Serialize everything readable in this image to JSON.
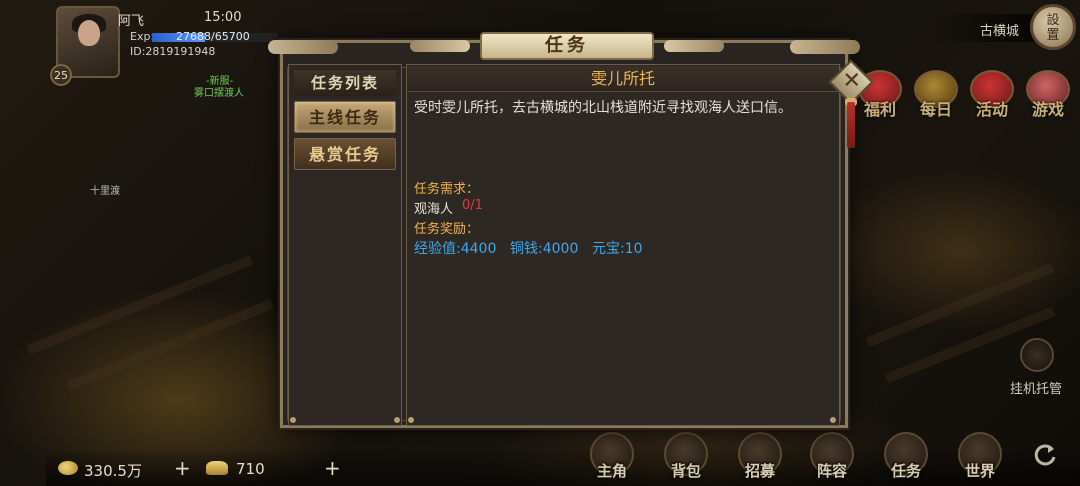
{
  "player": {
    "name": "阿飞",
    "time": "15:00",
    "exp_label": "Exp:",
    "exp_text": "27688/65700",
    "exp_fraction": 0.421,
    "id_text": "ID:2819191948",
    "level": "25"
  },
  "npc": {
    "tag": "-新服-",
    "name": "雾口摆渡人",
    "place": "十里渡"
  },
  "top_right": {
    "city": "古横城",
    "settings": "設\n置",
    "icons": [
      "福利",
      "每日",
      "活动",
      "游戏"
    ],
    "auto_label": "挂机托管"
  },
  "bottom": {
    "silver": "330.5万",
    "gold": "710",
    "plus": "+",
    "nav": [
      "主角",
      "背包",
      "招募",
      "阵容",
      "任务",
      "世界"
    ]
  },
  "dialog": {
    "title": "任务",
    "list_header": "任务列表",
    "tabs": [
      {
        "label": "主线任务",
        "active": true
      },
      {
        "label": "悬赏任务",
        "active": false
      }
    ],
    "close_symbol": "✕",
    "quest": {
      "name": "雯儿所托",
      "description": "受时雯儿所托，去古横城的北山栈道附近寻找观海人送口信。",
      "req_label": "任务需求：",
      "req_target": "观海人",
      "req_count": "0/1",
      "reward_label": "任务奖励：",
      "rewards": [
        "经验值:4400",
        "铜钱:4000",
        "元宝:10"
      ]
    }
  },
  "colors": {
    "accent_gold": "#f0b44a",
    "reward_blue": "#3ea8ea",
    "progress_red": "#e03b3b"
  }
}
